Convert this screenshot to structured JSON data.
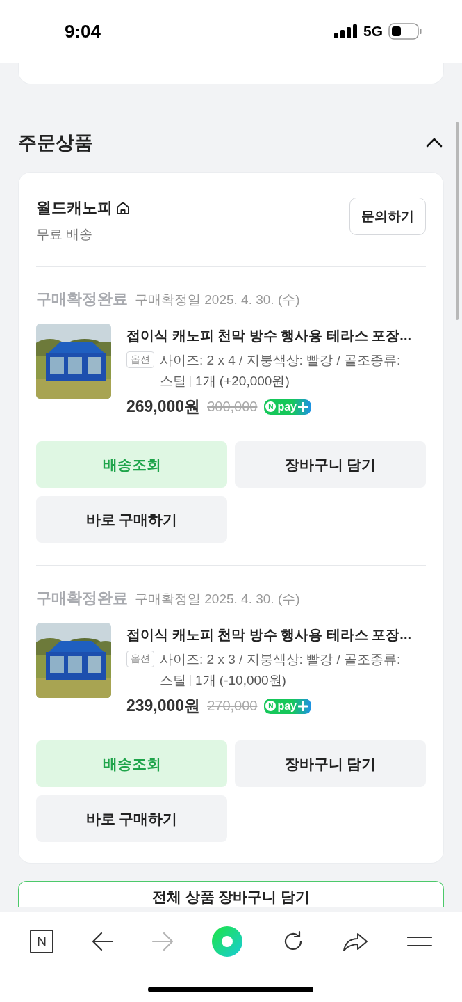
{
  "status_bar": {
    "time": "9:04",
    "network": "5G"
  },
  "section": {
    "title": "주문상품",
    "expanded": true
  },
  "seller": {
    "name": "월드캐노피",
    "shipping": "무료 배송",
    "inquiry_button": "문의하기"
  },
  "items": [
    {
      "status": "구매확정완료",
      "confirm_date": "구매확정일 2025. 4. 30. (수)",
      "title": "접이식 캐노피 천막 방수 행사용 테라스 포장...",
      "option_tag": "옵션",
      "option": "사이즈: 2 x 4 / 지붕색상: 빨강 / 골조종류: 스틸",
      "quantity": "1개 (+20,000원)",
      "price": "269,000원",
      "original_price": "300,000",
      "badge_mark": "N",
      "badge_text": "pay",
      "buttons": [
        {
          "label": "배송조회",
          "kind": "primary"
        },
        {
          "label": "장바구니 담기",
          "kind": "secondary"
        },
        {
          "label": "바로 구매하기",
          "kind": "secondary"
        }
      ]
    },
    {
      "status": "구매확정완료",
      "confirm_date": "구매확정일 2025. 4. 30. (수)",
      "title": "접이식 캐노피 천막 방수 행사용 테라스 포장...",
      "option_tag": "옵션",
      "option": "사이즈: 2 x 3 / 지붕색상: 빨강 / 골조종류: 스틸",
      "quantity": "1개 (-10,000원)",
      "price": "239,000원",
      "original_price": "270,000",
      "badge_mark": "N",
      "badge_text": "pay",
      "buttons": [
        {
          "label": "배송조회",
          "kind": "primary"
        },
        {
          "label": "장바구니 담기",
          "kind": "secondary"
        },
        {
          "label": "바로 구매하기",
          "kind": "secondary"
        }
      ]
    }
  ],
  "cart_all_button": "전체 상품 장바구니 담기",
  "browser_bar": {
    "home_label": "N",
    "forward_disabled": true
  }
}
